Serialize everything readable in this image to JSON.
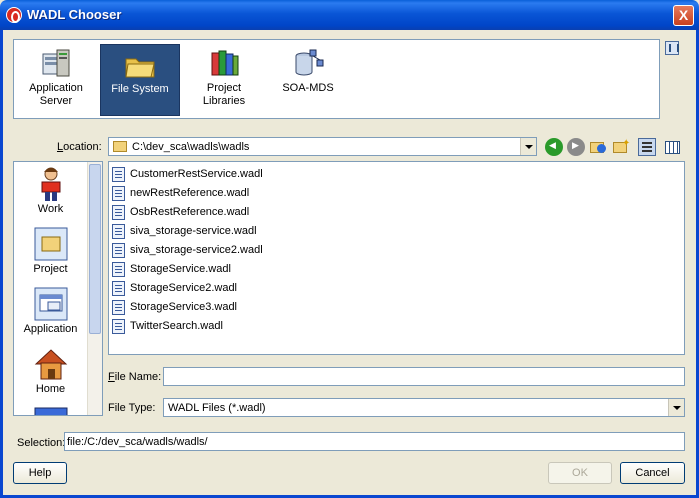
{
  "window": {
    "title": "WADL Chooser",
    "close_label": "X"
  },
  "categories": [
    {
      "label_line1": "Application",
      "label_line2": "Server",
      "icon": "application-server-icon",
      "selected": false
    },
    {
      "label_line1": "File System",
      "label_line2": "",
      "icon": "folder-icon",
      "selected": true
    },
    {
      "label_line1": "Project",
      "label_line2": "Libraries",
      "icon": "books-icon",
      "selected": false
    },
    {
      "label_line1": "SOA-MDS",
      "label_line2": "",
      "icon": "database-network-icon",
      "selected": false
    }
  ],
  "location": {
    "label_prefix": "L",
    "label_rest": "ocation:",
    "value": "C:\\dev_sca\\wadls\\wadls"
  },
  "shortcuts": [
    {
      "label": "Work",
      "icon": "person-icon"
    },
    {
      "label": "Project",
      "icon": "project-folder-icon"
    },
    {
      "label": "Application",
      "icon": "application-window-icon"
    },
    {
      "label": "Home",
      "icon": "home-icon"
    }
  ],
  "files": [
    "CustomerRestService.wadl",
    "newRestReference.wadl",
    "OsbRestReference.wadl",
    "siva_storage-service.wadl",
    "siva_storage-service2.wadl",
    "StorageService.wadl",
    "StorageService2.wadl",
    "StorageService3.wadl",
    "TwitterSearch.wadl"
  ],
  "file_name": {
    "label_prefix": "F",
    "label_rest": "ile Name:",
    "value": ""
  },
  "file_type": {
    "label_prefix": "",
    "label_rest": "File Type:",
    "value": "WADL Files (*.wadl)"
  },
  "selection": {
    "label": "Selection:",
    "value": "file:/C:/dev_sca/wadls/wadls/"
  },
  "buttons": {
    "help": "Help",
    "ok": "OK",
    "cancel": "Cancel"
  },
  "colors": {
    "titlebar": "#0a56d6",
    "selected_category": "#2a4f80",
    "dialog_bg": "#ece9d8"
  }
}
